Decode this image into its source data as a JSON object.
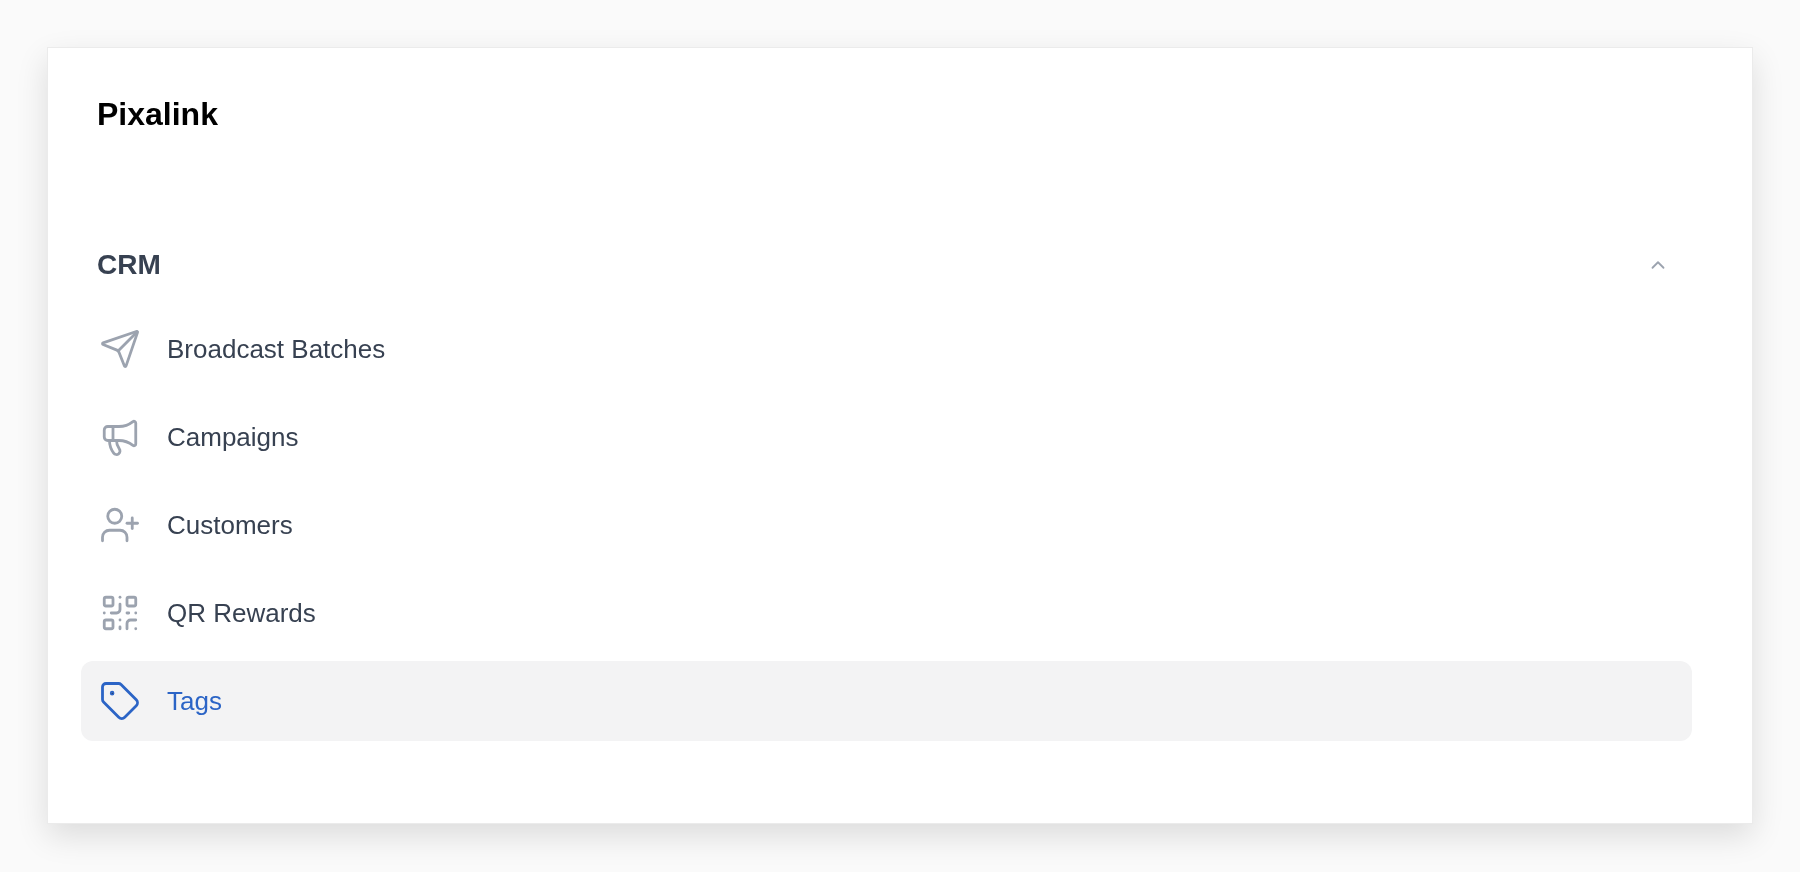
{
  "brand": "Pixalink",
  "section": {
    "title": "CRM",
    "expanded": true,
    "items": [
      {
        "label": "Broadcast Batches",
        "selected": false
      },
      {
        "label": "Campaigns",
        "selected": false
      },
      {
        "label": "Customers",
        "selected": false
      },
      {
        "label": "QR Rewards",
        "selected": false
      },
      {
        "label": "Tags",
        "selected": true
      }
    ]
  }
}
